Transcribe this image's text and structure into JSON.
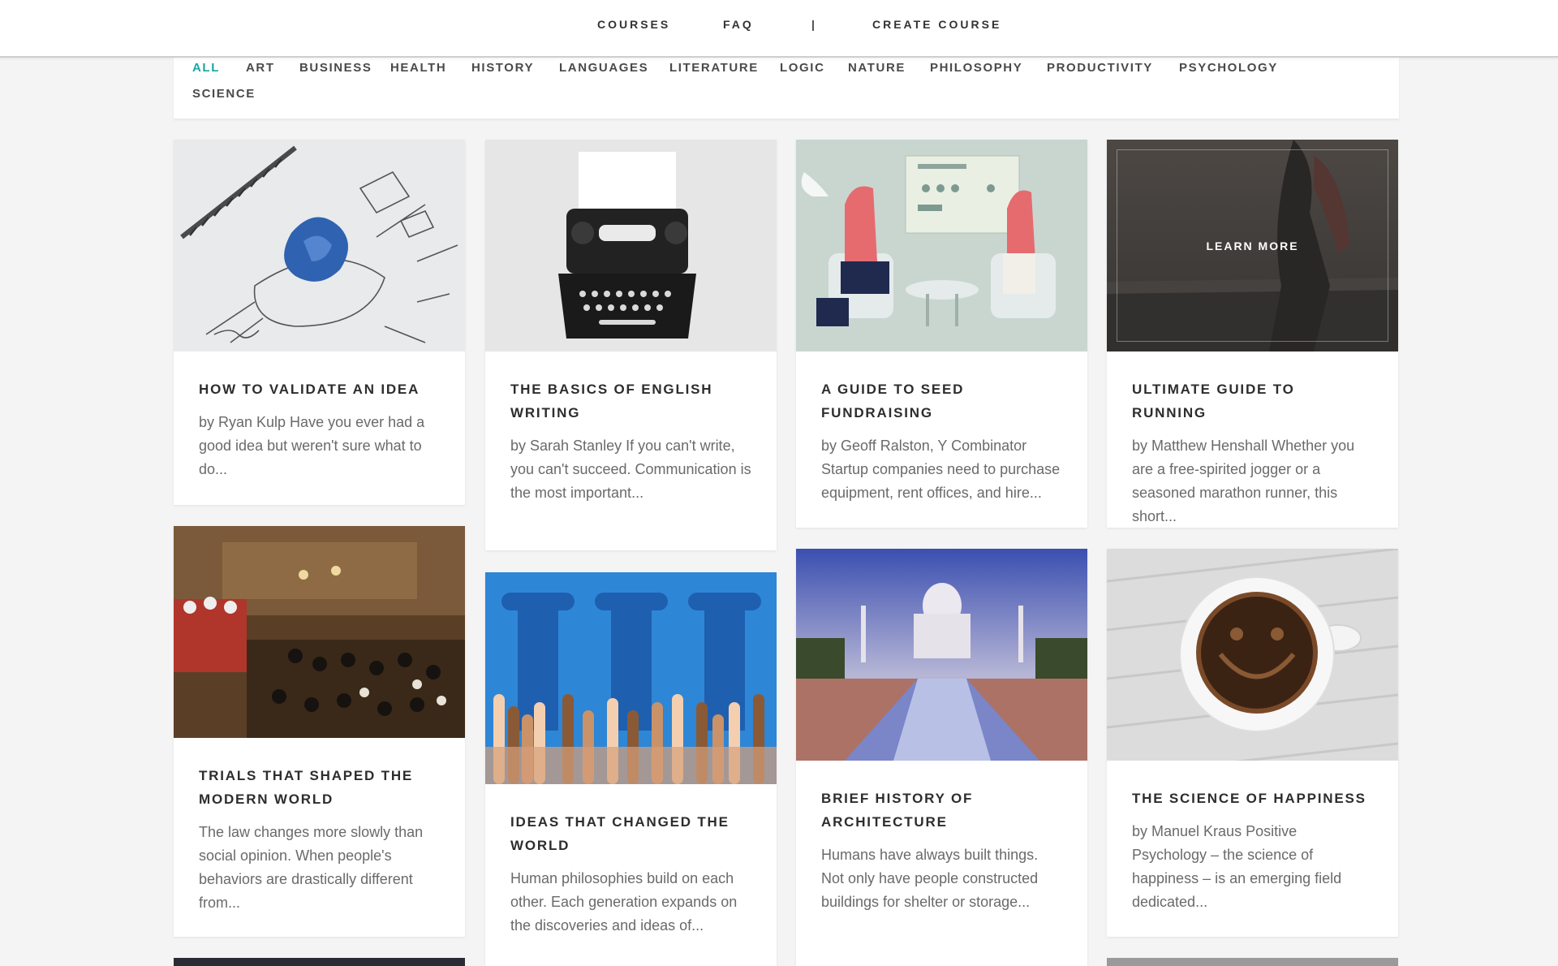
{
  "nav": {
    "courses": "COURSES",
    "faq": "FAQ",
    "separator": "|",
    "create_course": "CREATE COURSE"
  },
  "categories": [
    "ALL",
    "ART",
    "BUSINESS",
    "HEALTH",
    "HISTORY",
    "LANGUAGES",
    "LITERATURE",
    "LOGIC",
    "NATURE",
    "PHILOSOPHY",
    "PRODUCTIVITY",
    "PSYCHOLOGY",
    "SCIENCE"
  ],
  "active_category": "ALL",
  "colors": {
    "accent": "#1aa6a6",
    "heading": "#2d2d2d",
    "body_text": "#6a6a6a",
    "page_bg": "#f4f4f4"
  },
  "cards": [
    {
      "title": "HOW TO VALIDATE AN IDEA",
      "excerpt": "by Ryan Kulp Have you ever had a good idea but weren't sure what to do...",
      "image": "crumpled-paper-lightbulb-sketch"
    },
    {
      "title": "THE BASICS OF ENGLISH WRITING",
      "excerpt": "by Sarah Stanley If you can't write, you can't succeed. Communication is the most important...",
      "image": "typewriter"
    },
    {
      "title": "A GUIDE TO SEED FUNDRAISING",
      "excerpt": "by Geoff Ralston, Y Combinator Startup companies need to purchase equipment, rent offices, and hire...",
      "image": "investor-meeting-illustration"
    },
    {
      "title": "ULTIMATE GUIDE TO RUNNING",
      "excerpt": "by Matthew Henshall Whether you are a free-spirited jogger or a seasoned marathon runner, this short...",
      "image": "runner-on-road",
      "hover_label": "LEARN MORE"
    },
    {
      "title": "TRIALS THAT SHAPED THE MODERN WORLD",
      "excerpt": "The law changes more slowly than social opinion. When people's behaviors are drastically different from...",
      "image": "courtroom-painting"
    },
    {
      "title": "IDEAS THAT CHANGED THE WORLD",
      "excerpt": "Human philosophies build on each other. Each generation expands on the discoveries and ideas of...",
      "image": "columns-and-hands"
    },
    {
      "title": "BRIEF HISTORY OF ARCHITECTURE",
      "excerpt": "Humans have always built things. Not only have people constructed buildings for shelter or storage...",
      "image": "taj-mahal"
    },
    {
      "title": "THE SCIENCE OF HAPPINESS",
      "excerpt": "by Manuel Kraus Positive Psychology – the science of happiness – is an emerging field dedicated...",
      "image": "smiling-coffee-cup"
    }
  ]
}
